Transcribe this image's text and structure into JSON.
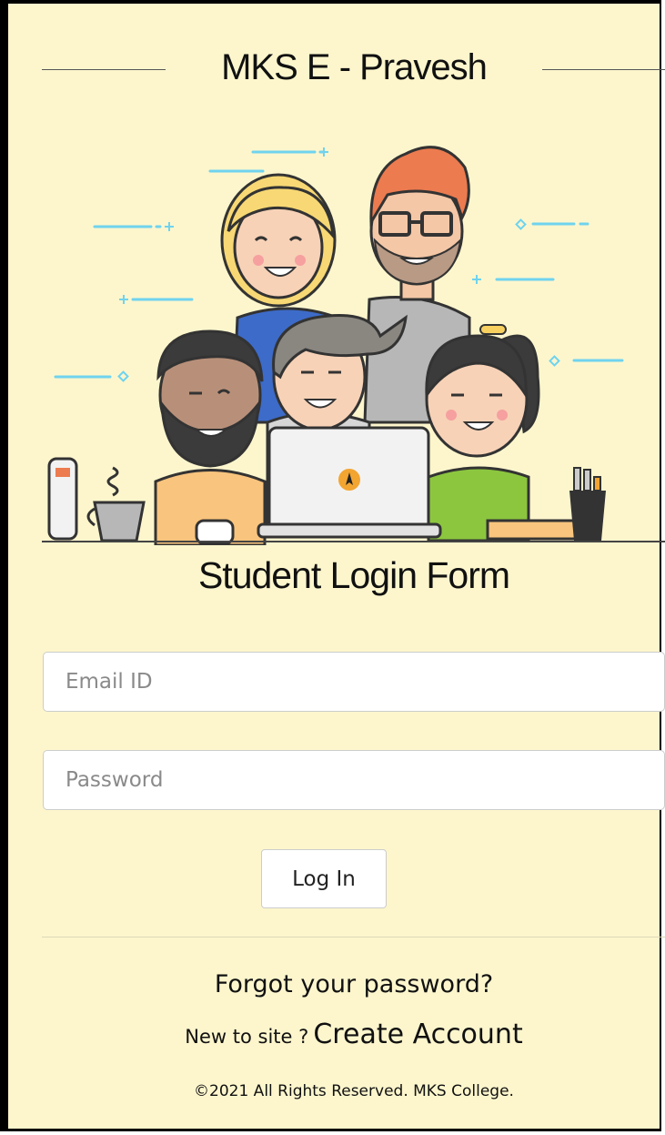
{
  "header": {
    "title": "MKS E - Pravesh"
  },
  "form": {
    "title": "Student Login Form",
    "email_placeholder": "Email ID",
    "password_placeholder": "Password",
    "login_label": "Log In"
  },
  "footer": {
    "forgot_label": "Forgot your password?",
    "new_to_site": "New to site ?",
    "create_account": "Create Account",
    "copyright": "©2021 All Rights Reserved. MKS College."
  },
  "colors": {
    "page_bg": "#fdf6cd",
    "accent_lines": "#6fd3ee",
    "laptop_logo": "#f2a531"
  },
  "illustration": {
    "icon": "students-with-laptop-illustration"
  }
}
